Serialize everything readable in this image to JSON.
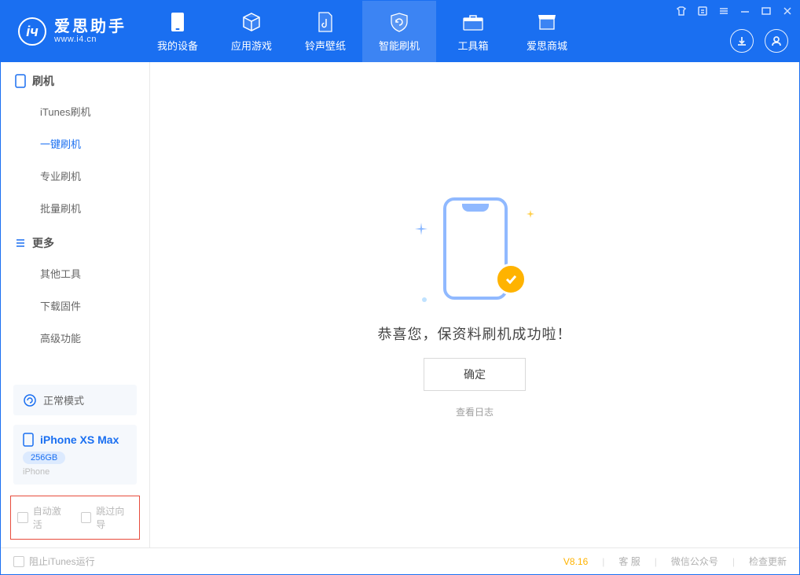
{
  "app": {
    "name_cn": "爱思助手",
    "name_en": "www.i4.cn"
  },
  "nav": {
    "tabs": [
      {
        "label": "我的设备"
      },
      {
        "label": "应用游戏"
      },
      {
        "label": "铃声壁纸"
      },
      {
        "label": "智能刷机"
      },
      {
        "label": "工具箱"
      },
      {
        "label": "爱思商城"
      }
    ]
  },
  "sidebar": {
    "group_flash": {
      "title": "刷机",
      "items": [
        {
          "label": "iTunes刷机"
        },
        {
          "label": "一键刷机"
        },
        {
          "label": "专业刷机"
        },
        {
          "label": "批量刷机"
        }
      ]
    },
    "group_more": {
      "title": "更多",
      "items": [
        {
          "label": "其他工具"
        },
        {
          "label": "下载固件"
        },
        {
          "label": "高级功能"
        }
      ]
    },
    "mode_box": {
      "label": "正常模式"
    },
    "device": {
      "name": "iPhone XS Max",
      "storage": "256GB",
      "subtype": "iPhone"
    },
    "options": {
      "auto_activate": "自动激活",
      "skip_guide": "跳过向导"
    }
  },
  "main": {
    "success_msg": "恭喜您，保资料刷机成功啦！",
    "ok_label": "确定",
    "view_log": "查看日志"
  },
  "footer": {
    "block_itunes": "阻止iTunes运行",
    "version": "V8.16",
    "links": [
      {
        "label": "客 服"
      },
      {
        "label": "微信公众号"
      },
      {
        "label": "检查更新"
      }
    ]
  }
}
